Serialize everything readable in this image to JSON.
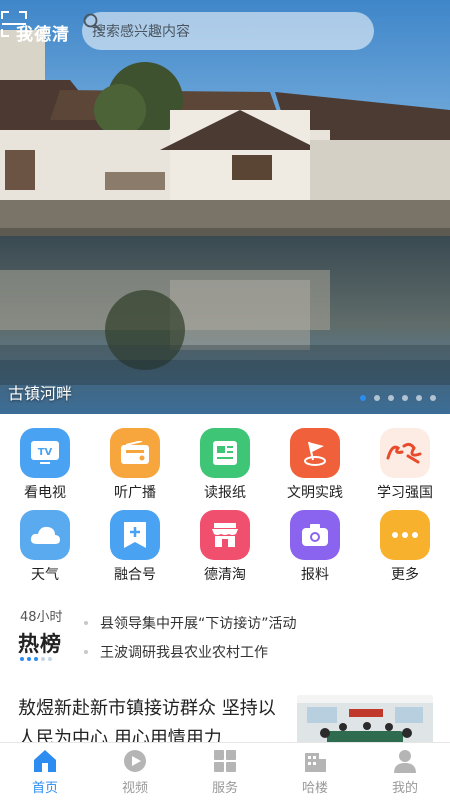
{
  "header": {
    "logo_text": "我德清",
    "search_placeholder": "搜索感兴趣内容"
  },
  "hero": {
    "caption": "古镇河畔",
    "slide_count": 6,
    "active_slide": 1
  },
  "grid": [
    {
      "label": "看电视",
      "icon": "tv-icon",
      "color": "#4aa3f2"
    },
    {
      "label": "听广播",
      "icon": "radio-icon",
      "color": "#f7a53d"
    },
    {
      "label": "读报纸",
      "icon": "newspaper-icon",
      "color": "#3fc576"
    },
    {
      "label": "文明实践",
      "icon": "flag-icon",
      "color": "#f0603a"
    },
    {
      "label": "学习强国",
      "icon": "xuexi-icon",
      "color": "#f26a3a"
    },
    {
      "label": "天气",
      "icon": "cloud-icon",
      "color": "#5aaaf0"
    },
    {
      "label": "融合号",
      "icon": "add-doc-icon",
      "color": "#4aa3f2"
    },
    {
      "label": "德清淘",
      "icon": "shop-icon",
      "color": "#f0506e"
    },
    {
      "label": "报料",
      "icon": "camera-icon",
      "color": "#8a63ee"
    },
    {
      "label": "更多",
      "icon": "more-icon",
      "color": "#f7b12d"
    }
  ],
  "hot": {
    "time_label": "48小时",
    "title": "热榜",
    "items": [
      "县领导集中开展“下访接访”活动",
      "王波调研我县农业农村工作"
    ]
  },
  "news": {
    "title": "敖煜新赴新市镇接访群众 坚持以人民为中心 用心用情用力"
  },
  "tabs": [
    {
      "label": "首页",
      "icon": "home-icon",
      "active": true
    },
    {
      "label": "视频",
      "icon": "video-icon",
      "active": false
    },
    {
      "label": "服务",
      "icon": "grid-icon",
      "active": false
    },
    {
      "label": "哈楼",
      "icon": "building-icon",
      "active": false
    },
    {
      "label": "我的",
      "icon": "user-icon",
      "active": false
    }
  ],
  "colors": {
    "accent": "#2d8cf0"
  }
}
